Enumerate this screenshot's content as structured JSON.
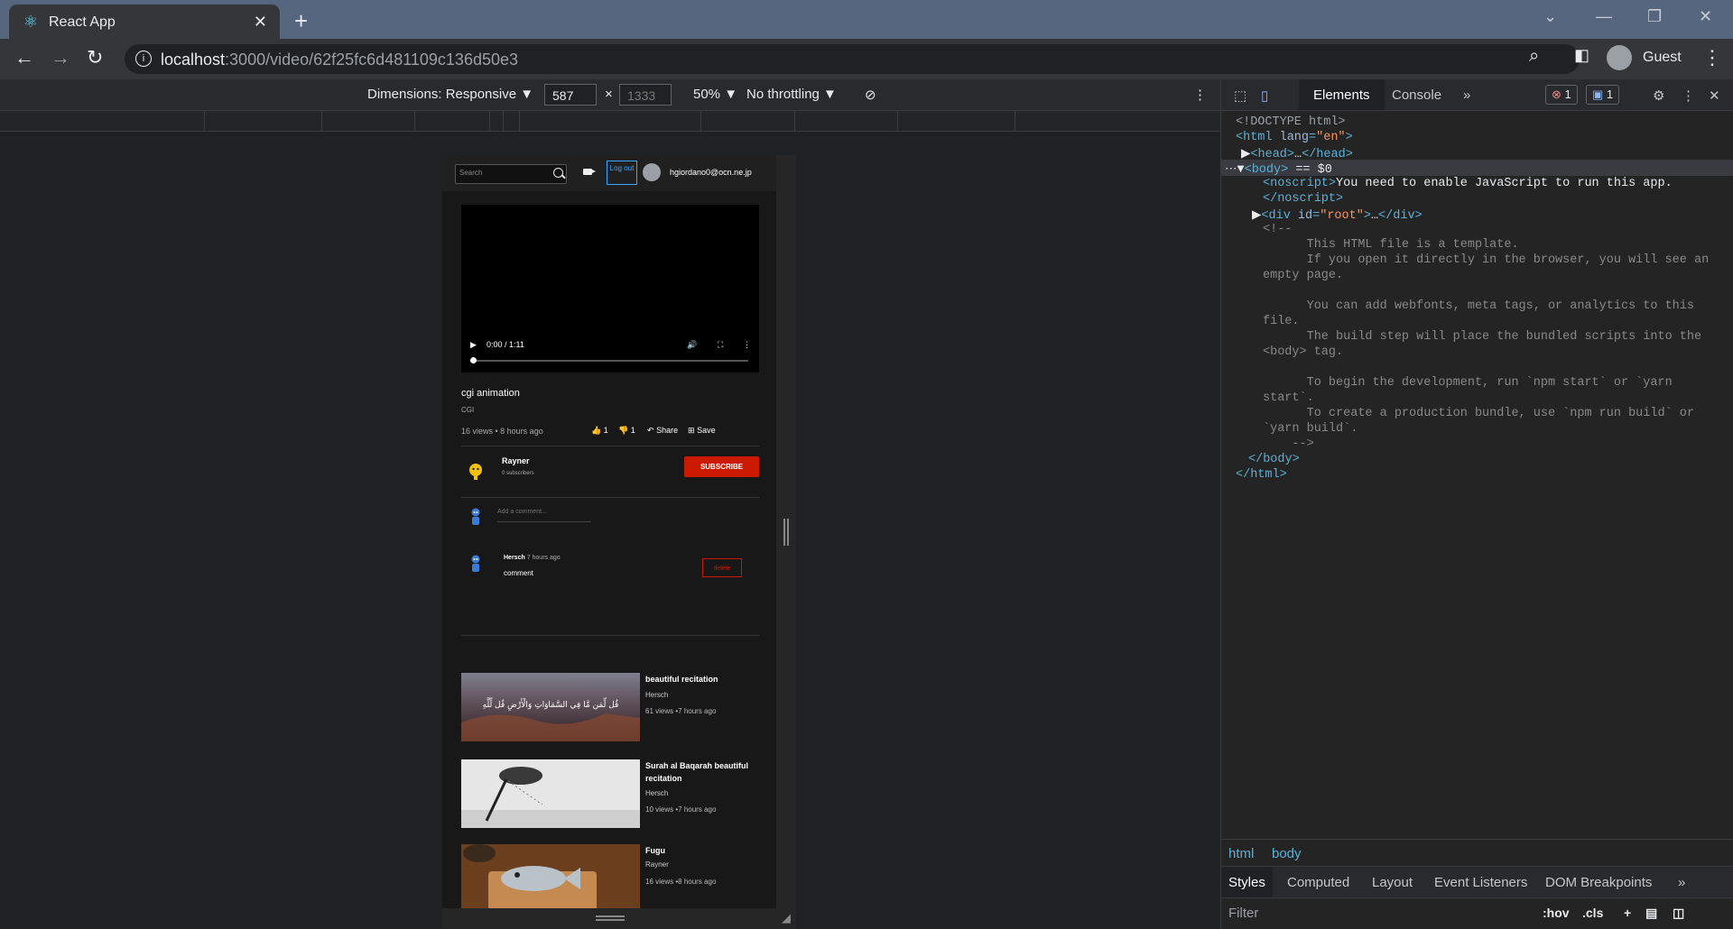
{
  "browser": {
    "tab_title": "React App",
    "url_host": "localhost",
    "url_path": ":3000/video/62f25fc6d481109c136d50e3",
    "profile_label": "Guest"
  },
  "device_toolbar": {
    "dimensions_label": "Dimensions: Responsive ▼",
    "width_value": "587",
    "height_value": "1333",
    "zoom_label": "50% ▼",
    "throttle_label": "No throttling ▼"
  },
  "app": {
    "search_placeholder": "Search",
    "logout_label": "Log out",
    "user_email": "hgiordano0@ocn.ne.jp",
    "player_time": "0:00 / 1:11",
    "video_title": "cgi animation",
    "video_category": "CGI",
    "video_meta": "16 views •  8 hours ago",
    "likes": "1",
    "dislikes": "1",
    "share_label": "Share",
    "save_label": "Save",
    "channel_name": "Rayner",
    "channel_subs": "0 subscribers",
    "subscribe_label": "SUBSCRIBE",
    "comment_placeholder": "Add a comment...",
    "comment": {
      "author": "Hersch",
      "time": "7 hours ago",
      "text": "comment",
      "delete_label": "delete"
    },
    "recommendations": [
      {
        "title": "beautiful recitation",
        "channel": "Hersch",
        "meta": "61 views •7 hours ago",
        "thumb_text": "قُل لِّمَن مَّا فِي السَّمَاوَاتِ وَالْأَرْضِ قُل لِّلَّهِ"
      },
      {
        "title": "Surah al Baqarah beautiful recitation",
        "channel": "Hersch",
        "meta": "10 views •7 hours ago"
      },
      {
        "title": "Fugu",
        "channel": "Rayner",
        "meta": "16 views •8 hours ago"
      }
    ]
  },
  "devtools": {
    "tabs": [
      "Elements",
      "Console"
    ],
    "error_count": "1",
    "message_count": "1",
    "dom_lines": {
      "doctype": "<!DOCTYPE html>",
      "body_suffix": " == $0",
      "noscript_text": "You need to enable JavaScript to run this app.",
      "comment_1": "      This HTML file is a template.",
      "comment_2": "      If you open it directly in the browser, you will see an",
      "comment_3": "empty page.",
      "comment_4": "      You can add webfonts, meta tags, or analytics to this",
      "comment_5": "file.",
      "comment_6": "      The build step will place the bundled scripts into the",
      "comment_7": "<body> tag.",
      "comment_8": "      To begin the development, run `npm start` or `yarn",
      "comment_9": "start`.",
      "comment_10": "      To create a production bundle, use `npm run build` or",
      "comment_11": "`yarn build`.",
      "comment_end": "    -->"
    },
    "breadcrumbs": [
      "html",
      "body"
    ],
    "styles_tabs": [
      "Styles",
      "Computed",
      "Layout",
      "Event Listeners",
      "DOM Breakpoints"
    ],
    "filter_placeholder": "Filter",
    "hov_label": ":hov",
    "cls_label": ".cls"
  }
}
